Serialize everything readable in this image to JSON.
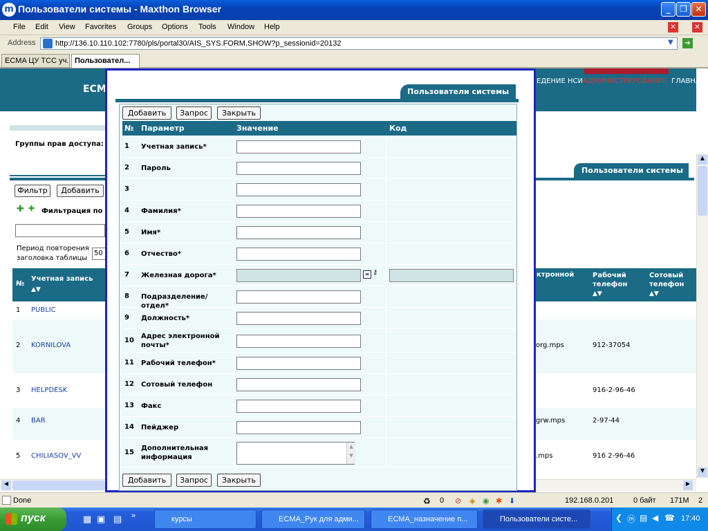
{
  "window": {
    "title": "Пользователи системы - Maxthon Browser"
  },
  "menu": [
    "File",
    "Edit",
    "View",
    "Favorites",
    "Groups",
    "Options",
    "Tools",
    "Window",
    "Help"
  ],
  "address": {
    "label": "Address",
    "url": "http://136.10.110.102:7780/pls/portal30/AIS_SYS.FORM.SHOW?p_sessionid=20132"
  },
  "tabs": [
    {
      "label": "ECMA ЦУ ТСС уч..."
    },
    {
      "label": "Пользовател..."
    }
  ],
  "background": {
    "brand": "ECMA",
    "nav_left": "ЕДЕНИЕ НСИ",
    "nav_active": "АДМИНИСТРИРОВАНИЕ",
    "nav_right": "ГЛАВНАЯ",
    "group_label": "Группы прав доступа:",
    "section_tab": "Пользователи системы",
    "filter_btn": "Фильтр",
    "add_btn": "Добавить",
    "filter_label": "Фильтрация по с",
    "period_label1": "Период повторения",
    "period_label2": "заголовка таблицы",
    "period_value": "50",
    "headers": {
      "num": "№",
      "account": "Учетная запись",
      "email": "ктронной",
      "work": "Рабочий телефон",
      "cell": "Сотовый телефон"
    },
    "rows": [
      {
        "num": "1",
        "account": "PUBLIC",
        "email": "",
        "work": ""
      },
      {
        "num": "2",
        "account": "KORNILOVA",
        "email": "org.mps",
        "work": "912-37054"
      },
      {
        "num": "3",
        "account": "HELPDESK",
        "email": "",
        "work": "916-2-96-46"
      },
      {
        "num": "4",
        "account": "BAR",
        "email": "grw.mps",
        "work": "2-97-44"
      },
      {
        "num": "5",
        "account": "CHILIASOV_VV",
        "email": ".mps",
        "work": "916 2-96-46"
      }
    ]
  },
  "modal": {
    "tab": "Пользователи системы",
    "buttons": {
      "add": "Добавить",
      "query": "Запрос",
      "close": "Закрыть"
    },
    "headers": {
      "num": "№",
      "param": "Параметр",
      "value": "Значение",
      "code": "Код"
    },
    "rows": [
      {
        "num": "1",
        "param": "Учетная запись*"
      },
      {
        "num": "2",
        "param": "Пароль"
      },
      {
        "num": "3",
        "param": ""
      },
      {
        "num": "4",
        "param": "Фамилия*"
      },
      {
        "num": "5",
        "param": "Имя*"
      },
      {
        "num": "6",
        "param": "Отчество*"
      },
      {
        "num": "7",
        "param": "Железная дорога*"
      },
      {
        "num": "8",
        "param": "Подразделение/отдел*"
      },
      {
        "num": "9",
        "param": "Должность*"
      },
      {
        "num": "10",
        "param": "Адрес электронной почты*"
      },
      {
        "num": "11",
        "param": "Рабочий телефон*"
      },
      {
        "num": "12",
        "param": "Сотовый телефон"
      },
      {
        "num": "13",
        "param": "Факс"
      },
      {
        "num": "14",
        "param": "Пейджер"
      },
      {
        "num": "15",
        "param": "Дополнительная информация"
      }
    ]
  },
  "status": {
    "text": "Done",
    "count": "0",
    "ip": "192.168.0.201",
    "bytes": "0 байт",
    "mem": "171M",
    "n": "2"
  },
  "taskbar": {
    "start": "пуск",
    "items": [
      "курсы",
      "ECMA_Рук для адми...",
      "ECMA_назначение п...",
      "Пользователи систе..."
    ],
    "clock": "17:40"
  },
  "colors": {
    "teal": "#1b6a86",
    "modal_border": "#1b25c4",
    "form_bg": "#eef9f9",
    "red_accent": "#aa1c2e"
  }
}
